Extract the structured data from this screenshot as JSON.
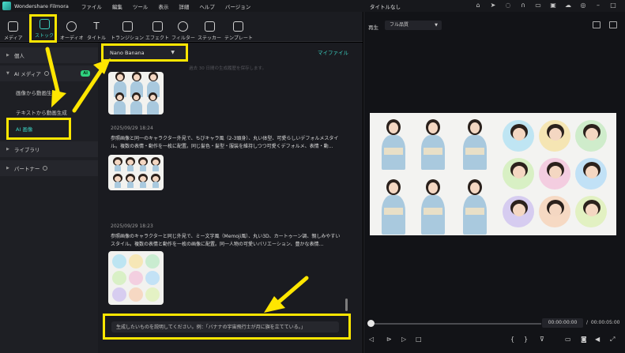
{
  "app": {
    "name": "Wondershare Filmora",
    "menu": [
      "ファイル",
      "編集",
      "ツール",
      "表示",
      "詳細",
      "ヘルプ",
      "バージョン"
    ],
    "document_title": "タイトルなし"
  },
  "toolbar": {
    "tabs": [
      {
        "label": "メディア",
        "icon": "media-icon"
      },
      {
        "label": "ストック",
        "icon": "stock-icon"
      },
      {
        "label": "オーディオ",
        "icon": "music-note-icon"
      },
      {
        "label": "タイトル",
        "icon": "title-t-icon"
      },
      {
        "label": "トランジション",
        "icon": "transition-icon"
      },
      {
        "label": "エフェクト",
        "icon": "effects-icon"
      },
      {
        "label": "フィルター",
        "icon": "filter-icon"
      },
      {
        "label": "ステッカー",
        "icon": "sticker-icon"
      },
      {
        "label": "テンプレート",
        "icon": "template-icon"
      }
    ],
    "active_tab": "ストック"
  },
  "sidebar": {
    "personal": "個人",
    "ai_media": "AI メディア",
    "ai_badge": "AI",
    "image_to_video": "画像から動画生成",
    "text_to_video": "テキストから動画生成",
    "ai_image": "AI 画像",
    "library": "ライブラリ",
    "partner": "パートナー"
  },
  "content": {
    "model": "Nano Banana",
    "my_files": "マイファイル",
    "faint_hint": "過去 30 日間の生成履歴を保存します。",
    "posts": [
      {
        "date": "2025/09/29 18:24",
        "text": "参照画像と同一のキャラクター外見で、ちびキャラ風（2-3頭身）、丸い体型、可愛らしいデフォルメスタイル。複数の表情・動作を一枚に配置。同じ髪色・髪型・服装を維持しつつ可愛くデフォルメ、表情・動…"
      },
      {
        "date": "2025/09/29 18:23",
        "text": "参照画像のキャラクターと同じ外見で、ミー文字風（Memoji風）、丸い3D、カートゥーン調、親しみやすいスタイル。複数の表情と動作を一枚の画像に配置。同一人物の可愛いバリエーション、豊かな表情…"
      }
    ],
    "prompt_placeholder": "生成したいものを説明してください。例：「バナナの宇宙飛行士が月に旗を立てている。」"
  },
  "preview": {
    "label": "再生",
    "quality": "フル品質",
    "current_time": "00:00:00:00",
    "separator": "/",
    "total_time": "00:00:05:00"
  },
  "colors": {
    "accent": "#3bd0c0",
    "highlight": "#ffe600",
    "ai_badge": "#2fd37f",
    "background": "#1a1b20"
  }
}
